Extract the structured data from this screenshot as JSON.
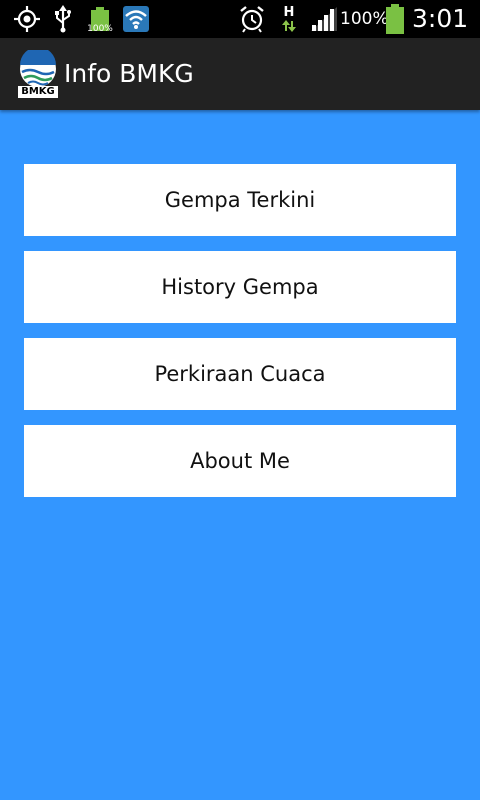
{
  "status_bar": {
    "icons_left": [
      "gps-icon",
      "usb-icon",
      "battery-small-icon",
      "wifi-icon"
    ],
    "battery_small_label": "100%",
    "icons_right": [
      "alarm-icon",
      "hspa-data-icon",
      "signal-icon",
      "battery-icon"
    ],
    "network_type": "H",
    "battery_percent": "100%",
    "time": "3:01"
  },
  "app_bar": {
    "logo_text": "BMKG",
    "title": "Info BMKG",
    "background": "#222222"
  },
  "main": {
    "background": "#3396FF",
    "buttons": [
      {
        "label": "Gempa Terkini"
      },
      {
        "label": "History Gempa"
      },
      {
        "label": "Perkiraan Cuaca"
      },
      {
        "label": "About Me"
      }
    ]
  }
}
